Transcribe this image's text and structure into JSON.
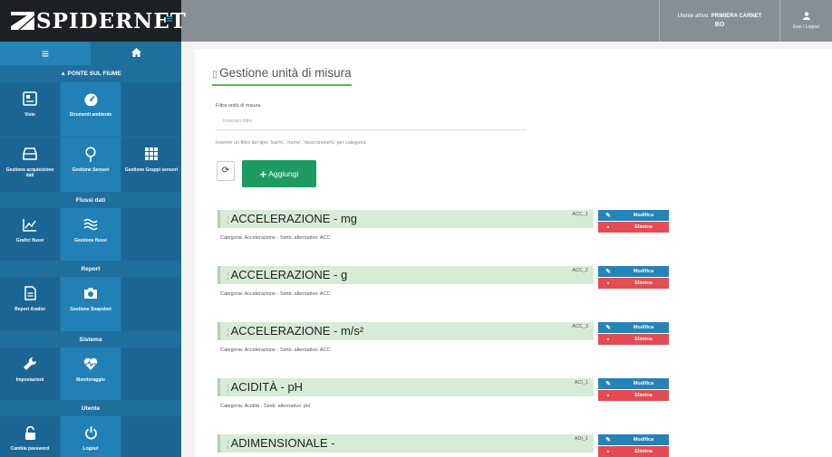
{
  "app": {
    "brand": "SPIDERNET",
    "menu_icon": "hamburger-icon"
  },
  "topbar": {
    "user_label": "Utente attivo:",
    "user_name": "PRIMIERA CARNET",
    "user_code": "BO",
    "exit_label": "Esci / Logout"
  },
  "sidebar": {
    "head_left_icon": "hamburger-icon",
    "head_right_icon": "home-icon",
    "project": "▲ PONTE SUL FIUME",
    "sections": {
      "flussi": "Flussi dati",
      "report": "Report",
      "sistema": "Sistema",
      "utente": "Utente"
    },
    "tiles": {
      "viste": "Viste",
      "strumenti_ambiente": "Strumenti ambiente",
      "gestione_acquisizione": "Gestione acquisizione dati",
      "gestione_sensori": "Gestione Sensori",
      "gestione_gruppi": "Gestione Gruppi sensori",
      "grafici_flussi": "Grafici flussi",
      "gestione_flussi": "Gestione flussi",
      "report_analisi": "Report Analisi",
      "gestione_snapshot": "Gestione Snapshot",
      "impostazioni": "Impostazioni",
      "monitoraggio": "Monitoraggio",
      "cambia_password": "Cambia password",
      "logout": "Logout"
    }
  },
  "page": {
    "title": "Gestione unità di misura",
    "filter_label": "Filtra unità di misura",
    "filter_placeholder": "Inserisci filtro",
    "filter_value": "",
    "filter_help": "Inserire un filtro del tipo: 'bar%', 'nome', 'descrizione%' per categoria",
    "refresh_icon": "refresh-icon",
    "add_label": "Aggiungi",
    "edit_label": "Modifica",
    "delete_label": "Elimina"
  },
  "units": [
    {
      "title": "ACCELERAZIONE - mg",
      "code": "ACC_1",
      "desc": "Categoria: Accelerazione - Simb. alternativo: ACC"
    },
    {
      "title": "ACCELERAZIONE - g",
      "code": "ACC_2",
      "desc": "Categoria: Accelerazione - Simb. alternativo: ACC"
    },
    {
      "title": "ACCELERAZIONE - m/s²",
      "code": "ACC_3",
      "desc": "Categoria: Accelerazione - Simb. alternativo: ACC"
    },
    {
      "title": "ACIDITÀ - pH",
      "code": "ACI_1",
      "desc": "Categoria: Acidità - Simb. alternativo: pH"
    },
    {
      "title": "ADIMENSIONALE -",
      "code": "ADI_1",
      "desc": ""
    }
  ],
  "colors": {
    "sidebar": "#1f6f9e",
    "brand_bg": "#1c2024",
    "topbar": "#888f94",
    "accent_green": "#1e9a63",
    "edit_blue": "#2583b8",
    "delete_red": "#e54b52",
    "unit_bar": "#d6ecd6"
  }
}
